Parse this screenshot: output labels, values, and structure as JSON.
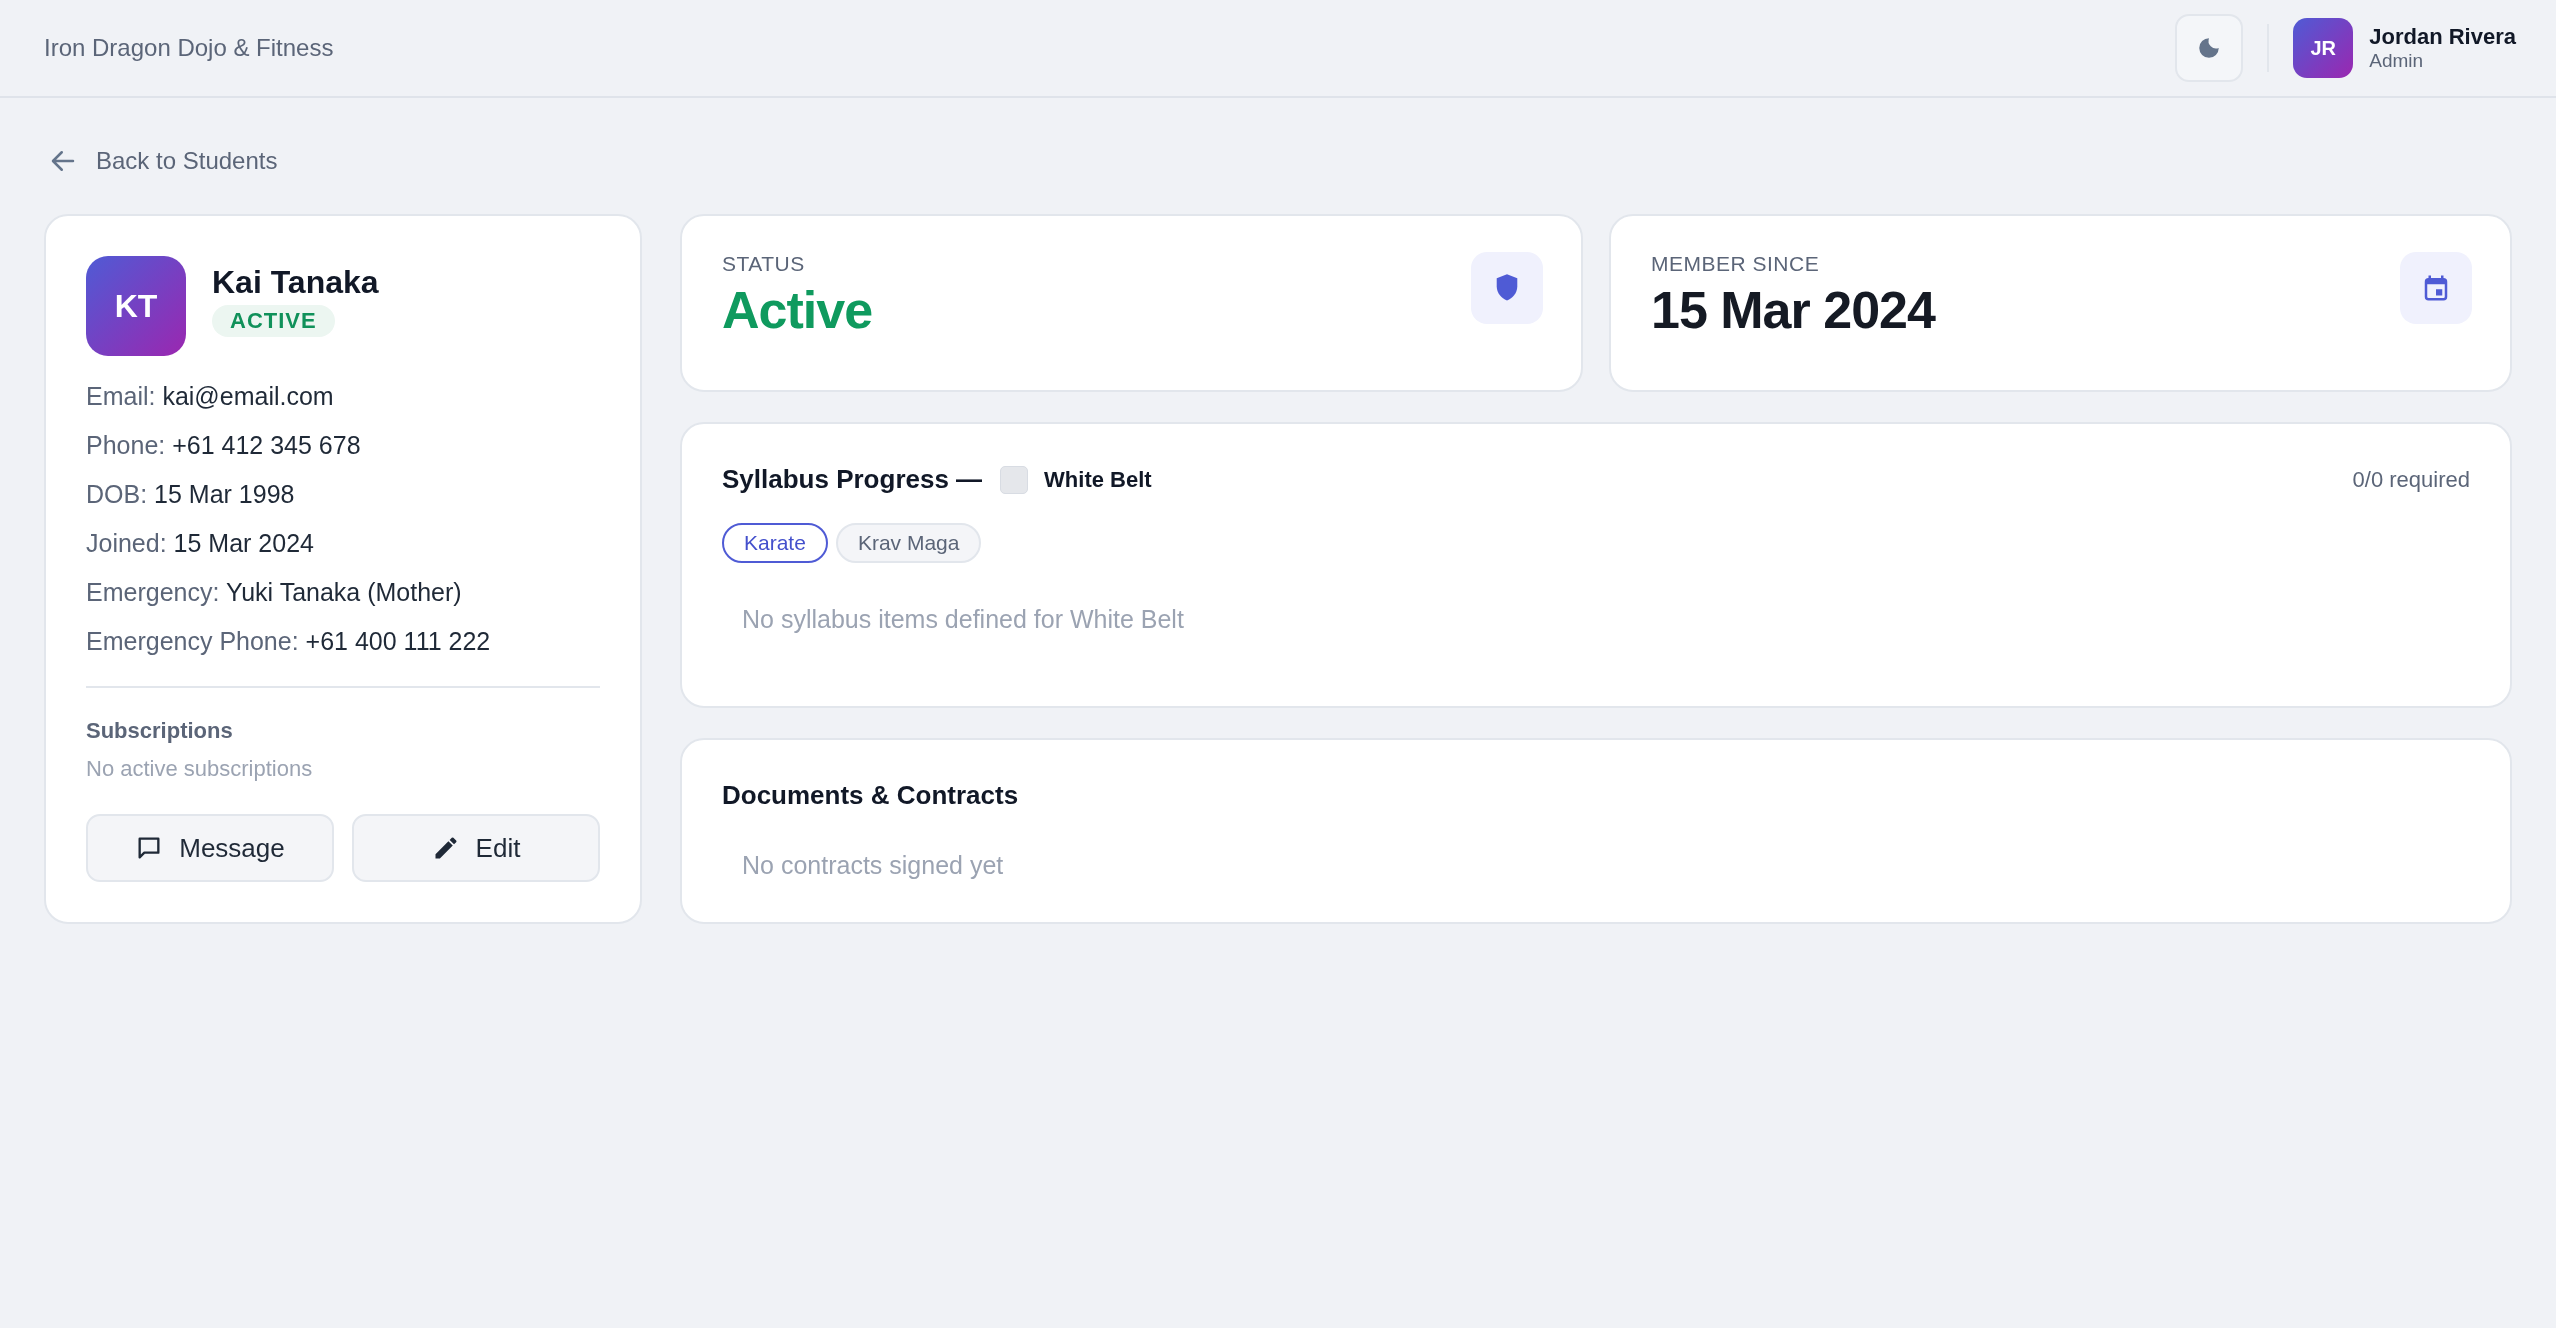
{
  "header": {
    "brand": "Iron Dragon Dojo & Fitness",
    "user": {
      "initials": "JR",
      "name": "Jordan Rivera",
      "role": "Admin"
    }
  },
  "back_link": "Back to Students",
  "profile": {
    "initials": "KT",
    "name": "Kai Tanaka",
    "badge": "ACTIVE",
    "details": [
      {
        "label": "Email:",
        "value": "kai@email.com"
      },
      {
        "label": "Phone:",
        "value": "+61 412 345 678"
      },
      {
        "label": "DOB:",
        "value": "15 Mar 1998"
      },
      {
        "label": "Joined:",
        "value": "15 Mar 2024"
      },
      {
        "label": "Emergency:",
        "value": "Yuki Tanaka (Mother)"
      },
      {
        "label": "Emergency Phone:",
        "value": "+61 400 111 222"
      }
    ],
    "subscriptions": {
      "title": "Subscriptions",
      "empty": "No active subscriptions"
    },
    "buttons": [
      {
        "kind": "message",
        "label": "Message"
      },
      {
        "kind": "edit",
        "label": "Edit"
      }
    ]
  },
  "stats": [
    {
      "kind": "status",
      "label": "STATUS",
      "value": "Active"
    },
    {
      "kind": "date",
      "label": "MEMBER SINCE",
      "value": "15 Mar 2024"
    }
  ],
  "syllabus": {
    "title": "Syllabus Progress —",
    "belt": {
      "name": "White Belt",
      "color": "#e5e7eb"
    },
    "count": "0/0 required",
    "tabs": [
      {
        "label": "Karate",
        "selected": true
      },
      {
        "label": "Krav Maga",
        "selected": false
      }
    ],
    "empty": "No syllabus items defined for White Belt"
  },
  "documents": {
    "title": "Documents & Contracts",
    "empty": "No contracts signed yet"
  }
}
